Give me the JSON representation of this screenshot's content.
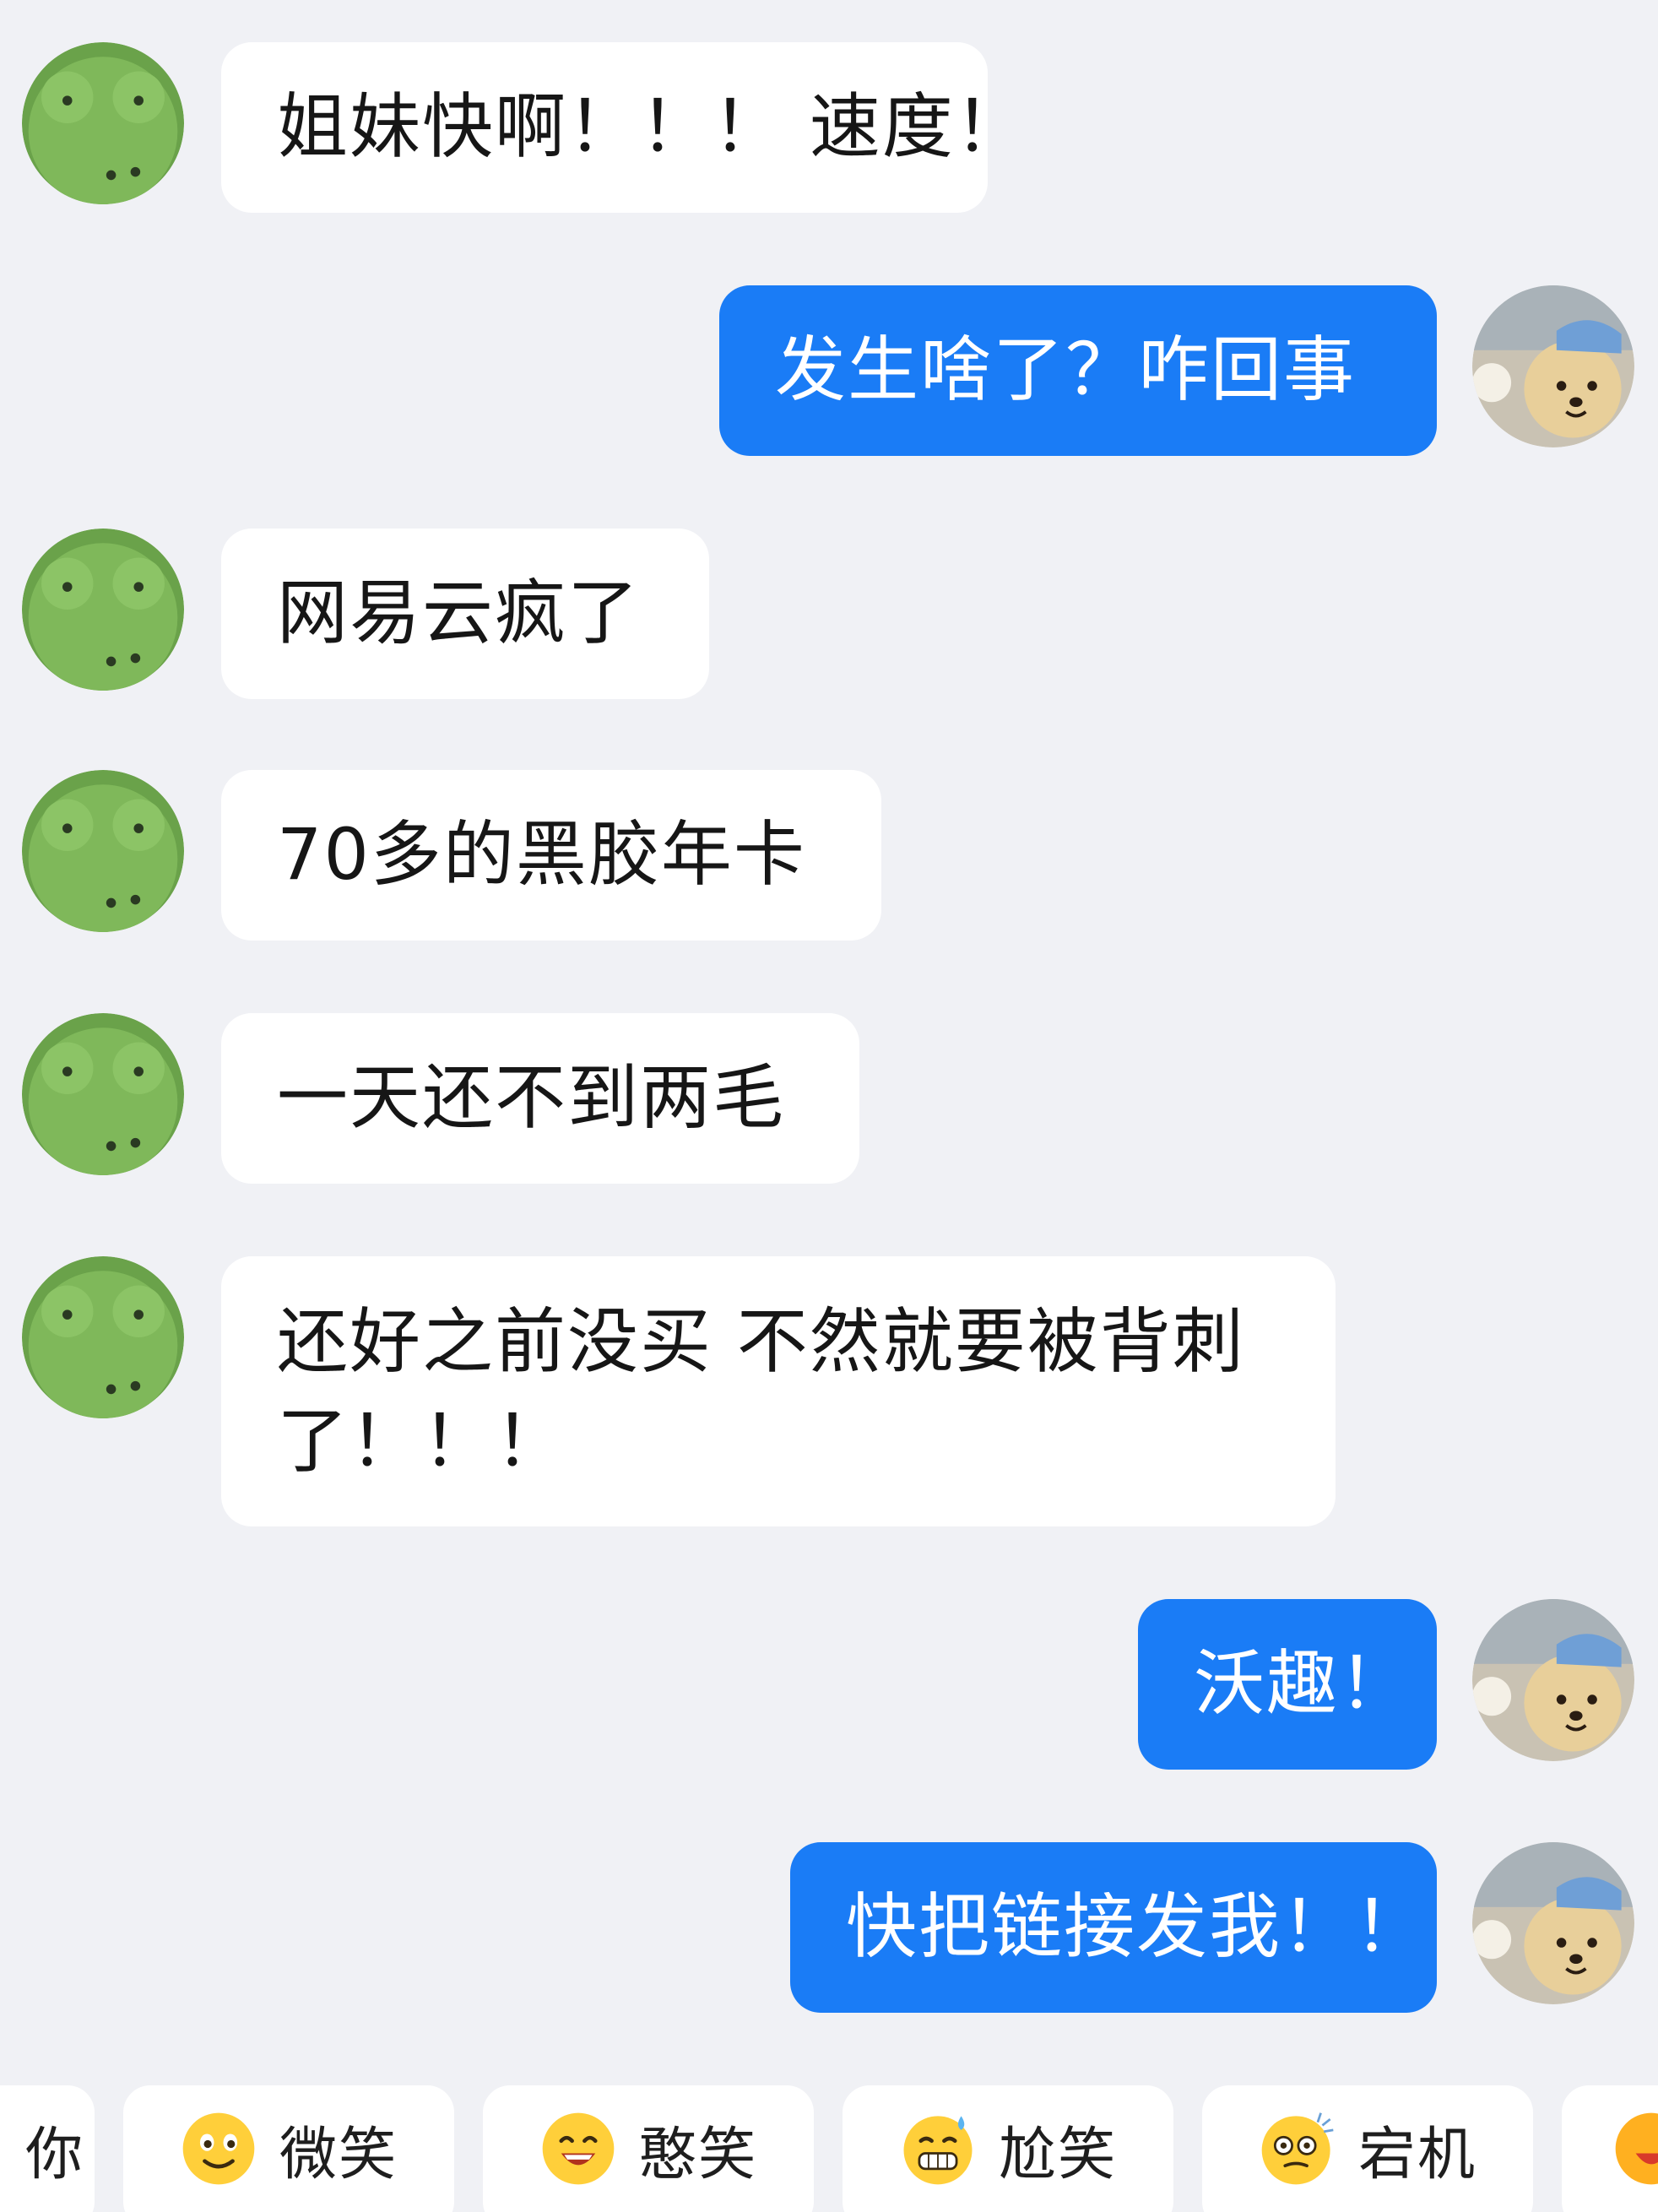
{
  "messages": [
    {
      "side": "in",
      "text": "姐妹快啊！！！ 速度！"
    },
    {
      "side": "out",
      "text": "发生啥了？咋回事"
    },
    {
      "side": "in",
      "text": "网易云疯了"
    },
    {
      "side": "in",
      "text": "70多的黑胶年卡"
    },
    {
      "side": "in",
      "text": "一天还不到两毛"
    },
    {
      "side": "in",
      "text": "还好之前没买 不然就要被背刺了！！！"
    },
    {
      "side": "out",
      "text": "沃趣！"
    },
    {
      "side": "out",
      "text": "快把链接发我！！"
    }
  ],
  "quick_replies": [
    {
      "label": "你",
      "icon": "emoji-icon"
    },
    {
      "label": "微笑",
      "icon": "smile-emoji-icon"
    },
    {
      "label": "憨笑",
      "icon": "grin-emoji-icon"
    },
    {
      "label": "尬笑",
      "icon": "awkward-sweat-emoji-icon"
    },
    {
      "label": "宕机",
      "icon": "dizzy-emoji-icon"
    }
  ],
  "colors": {
    "background": "#f0f1f5",
    "incoming_bubble": "#ffffff",
    "outgoing_bubble": "#1a7cf6"
  }
}
